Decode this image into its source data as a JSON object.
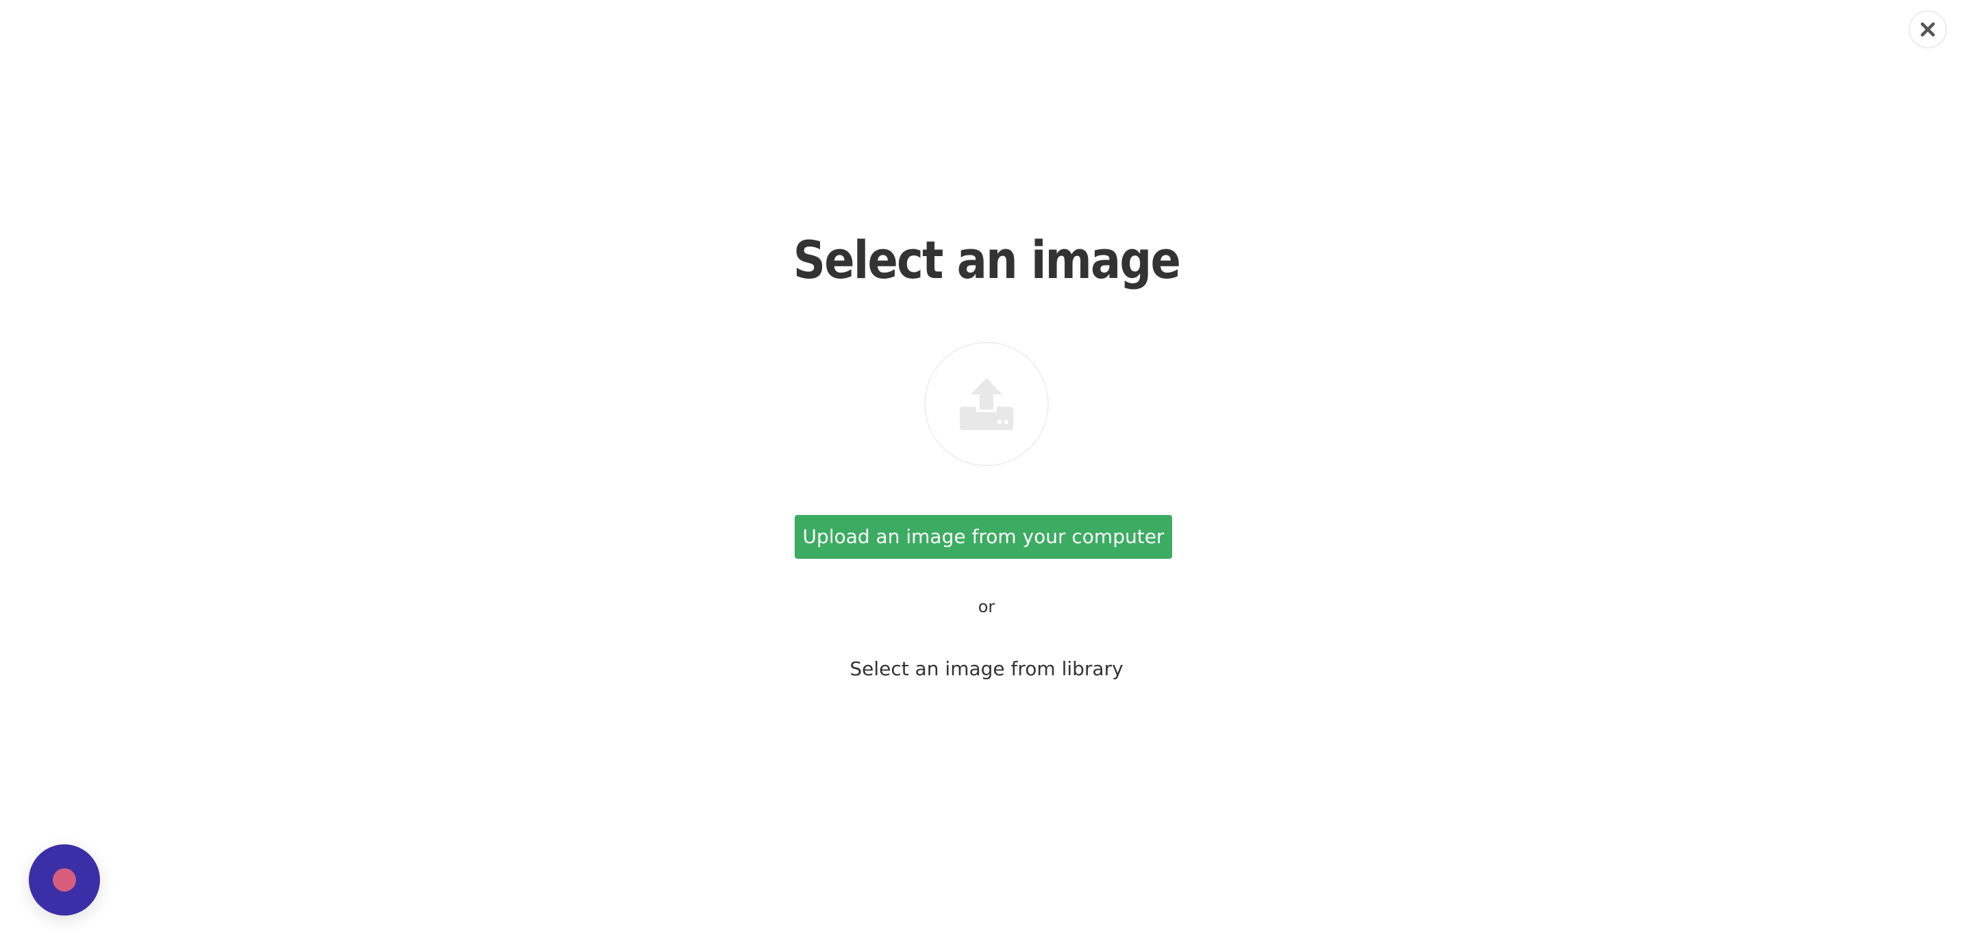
{
  "modal": {
    "title": "Select an image",
    "upload_button_label": "Upload an image from your computer",
    "separator_text": "or",
    "library_link_label": "Select an image from library"
  },
  "icons": {
    "close": "close-icon",
    "upload": "upload-icon",
    "chat": "chat-widget-icon"
  },
  "colors": {
    "primary_button": "#3cac62",
    "chat_widget_bg": "#3a2fa6",
    "chat_widget_dot": "#d75d7c",
    "text": "#333333"
  }
}
